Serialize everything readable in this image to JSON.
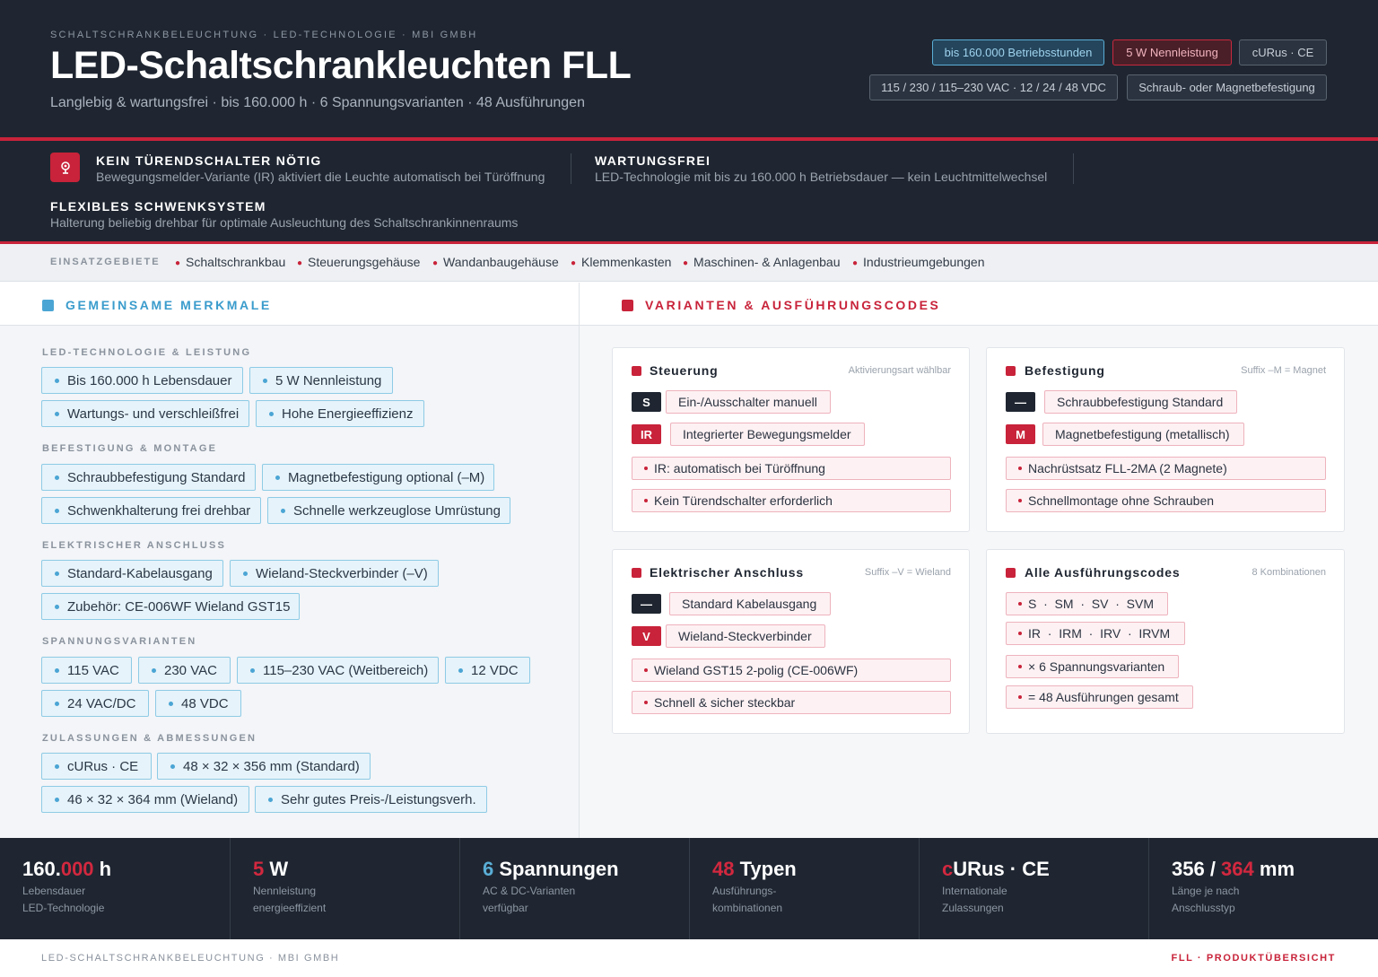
{
  "header": {
    "eyebrow": "SCHALTSCHRANKBELEUCHTUNG · LED-TECHNOLOGIE · MBI GMBH",
    "title": "LED-Schaltschrankleuchten FLL",
    "subtitle": "Langlebig & wartungsfrei · bis 160.000 h · 6 Spannungsvarianten · 48 Ausführungen",
    "badges": [
      "bis 160.000 Betriebsstunden",
      "5 W Nennleistung",
      "cURus · CE",
      "115 / 230 / 115–230 VAC · 12 / 24 / 48 VDC",
      "Schraub- oder Magnetbefestigung"
    ]
  },
  "features": [
    {
      "title": "KEIN TÜRENDSCHALTER NÖTIG",
      "desc": "Bewegungsmelder-Variante (IR) aktiviert die Leuchte automatisch bei Türöffnung"
    },
    {
      "title": "WARTUNGSFREI",
      "desc": "LED-Technologie mit bis zu 160.000 h Betriebsdauer — kein Leuchtmittelwechsel"
    },
    {
      "title": "FLEXIBLES SCHWENKSYSTEM",
      "desc": "Halterung beliebig drehbar für optimale Ausleuchtung des Schaltschrankinnenraums"
    }
  ],
  "usage": {
    "label": "EINSATZGEBIETE",
    "items": [
      "Schaltschrankbau",
      "Steuerungsgehäuse",
      "Wandanbaugehäuse",
      "Klemmenkasten",
      "Maschinen- & Anlagenbau",
      "Industrieumgebungen"
    ]
  },
  "left": {
    "title": "GEMEINSAME MERKMALE",
    "groups": [
      {
        "label": "LED-TECHNOLOGIE & LEISTUNG",
        "chips": [
          "Bis 160.000 h Lebensdauer",
          "5 W Nennleistung",
          "Wartungs- und verschleißfrei",
          "Hohe Energieeffizienz"
        ]
      },
      {
        "label": "BEFESTIGUNG & MONTAGE",
        "chips": [
          "Schraubbefestigung Standard",
          "Magnetbefestigung optional (–M)",
          "Schwenkhalterung frei drehbar",
          "Schnelle werkzeuglose Umrüstung"
        ]
      },
      {
        "label": "ELEKTRISCHER ANSCHLUSS",
        "chips": [
          "Standard-Kabelausgang",
          "Wieland-Steckverbinder (–V)",
          "Zubehör: CE-006WF Wieland GST15"
        ]
      },
      {
        "label": "SPANNUNGSVARIANTEN",
        "chips": [
          "115 VAC",
          "230 VAC",
          "115–230 VAC (Weitbereich)",
          "12 VDC",
          "24 VAC/DC",
          "48 VDC"
        ]
      },
      {
        "label": "ZULASSUNGEN & ABMESSUNGEN",
        "chips": [
          "cURus · CE",
          "48 × 32 × 356 mm (Standard)",
          "46 × 32 × 364 mm (Wieland)",
          "Sehr gutes Preis-/Leistungsverh."
        ]
      }
    ]
  },
  "right": {
    "title": "VARIANTEN & AUSFÜHRUNGSCODES",
    "cards": [
      {
        "title": "Steuerung",
        "note": "Aktivierungsart wählbar",
        "options": [
          {
            "code": "S",
            "label": "Ein-/Ausschalter manuell"
          },
          {
            "code": "IR",
            "label": "Integrierter Bewegungsmelder"
          }
        ],
        "bullets": [
          "IR: automatisch bei Türöffnung",
          "Kein Türendschalter erforderlich"
        ]
      },
      {
        "title": "Befestigung",
        "note": "Suffix –M = Magnet",
        "options": [
          {
            "code": "—",
            "label": "Schraubbefestigung Standard"
          },
          {
            "code": "M",
            "label": "Magnetbefestigung (metallisch)"
          }
        ],
        "bullets": [
          "Nachrüstsatz FLL-2MA (2 Magnete)",
          "Schnellmontage ohne Schrauben"
        ]
      },
      {
        "title": "Elektrischer Anschluss",
        "note": "Suffix –V = Wieland",
        "options": [
          {
            "code": "—",
            "label": "Standard Kabelausgang"
          },
          {
            "code": "V",
            "label": "Wieland-Steckverbinder"
          }
        ],
        "bullets": [
          "Wieland GST15 2-polig (CE-006WF)",
          "Schnell & sicher steckbar"
        ]
      },
      {
        "title": "Alle Ausführungscodes",
        "note": "8 Kombinationen",
        "bullets": [
          "S  ·  SM  ·  SV  ·  SVM",
          "IR  ·  IRM  ·  IRV  ·  IRVM",
          "× 6 Spannungsvarianten",
          "= 48 Ausführungen gesamt"
        ]
      }
    ]
  },
  "stats": [
    {
      "pre": "160.",
      "acc": "000",
      "post": " h",
      "l1": "Lebensdauer",
      "l2": "LED-Technologie"
    },
    {
      "pre": "",
      "acc": "5",
      "post": " W",
      "l1": "Nennleistung",
      "l2": "energieeffizient"
    },
    {
      "pre": "",
      "acc": "6",
      "post": " Spannungen",
      "l1": "AC & DC-Varianten",
      "l2": "verfügbar"
    },
    {
      "pre": "",
      "acc": "48",
      "post": " Typen",
      "l1": "Ausführungs-",
      "l2": "kombinationen"
    },
    {
      "pre": "",
      "acc": "c",
      "post": "URus · CE",
      "l1": "Internationale",
      "l2": "Zulassungen"
    },
    {
      "pre": "356 / ",
      "acc": "364",
      "post": " mm",
      "l1": "Länge je nach",
      "l2": "Anschlusstyp"
    }
  ],
  "footer": {
    "left": "LED-SCHALTSCHRANKBELEUCHTUNG · MBI GMBH",
    "right": "FLL · PRODUKTÜBERSICHT"
  },
  "colors": {
    "accent_red": "#c8233a",
    "accent_blue": "#4ba5d4",
    "dark_bg": "#1f2631"
  },
  "icons": {
    "feature_icon": "sensor-icon"
  }
}
